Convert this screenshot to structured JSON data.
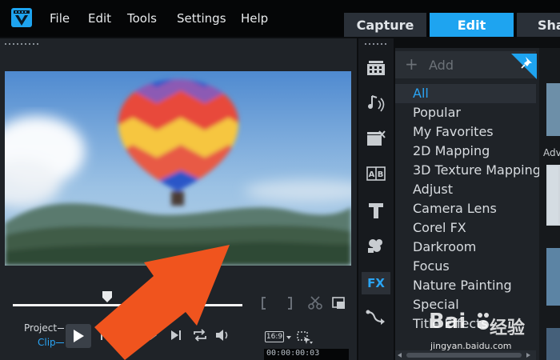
{
  "menubar": {
    "items": [
      {
        "label": "File"
      },
      {
        "label": "Edit"
      },
      {
        "label": "Tools"
      },
      {
        "label": "Settings"
      },
      {
        "label": "Help"
      }
    ]
  },
  "tabs": [
    {
      "label": "Capture"
    },
    {
      "label": "Edit",
      "active": true
    },
    {
      "label": "Sha"
    }
  ],
  "player": {
    "mode_project": "Project",
    "mode_clip": "Clip",
    "aspect": "16:9",
    "timecode": "00:00:00:03"
  },
  "library": {
    "add_label": "Add",
    "categories": [
      {
        "label": "All",
        "selected": true
      },
      {
        "label": "Popular"
      },
      {
        "label": "My Favorites"
      },
      {
        "label": "2D Mapping"
      },
      {
        "label": "3D Texture Mapping"
      },
      {
        "label": "Adjust"
      },
      {
        "label": "Camera Lens"
      },
      {
        "label": "Corel FX"
      },
      {
        "label": "Darkroom"
      },
      {
        "label": "Focus"
      },
      {
        "label": "Nature Painting"
      },
      {
        "label": "Special"
      },
      {
        "label": "Title Effects"
      }
    ],
    "fx_label": "FX",
    "thumb_caption": "Adv"
  },
  "watermark": {
    "text": "Bai 经验",
    "url": "jingyan.baidu.com"
  },
  "colors": {
    "accent": "#1ea4f0",
    "arrow": "#f0541e",
    "selected_category": "#2aa4f4"
  }
}
